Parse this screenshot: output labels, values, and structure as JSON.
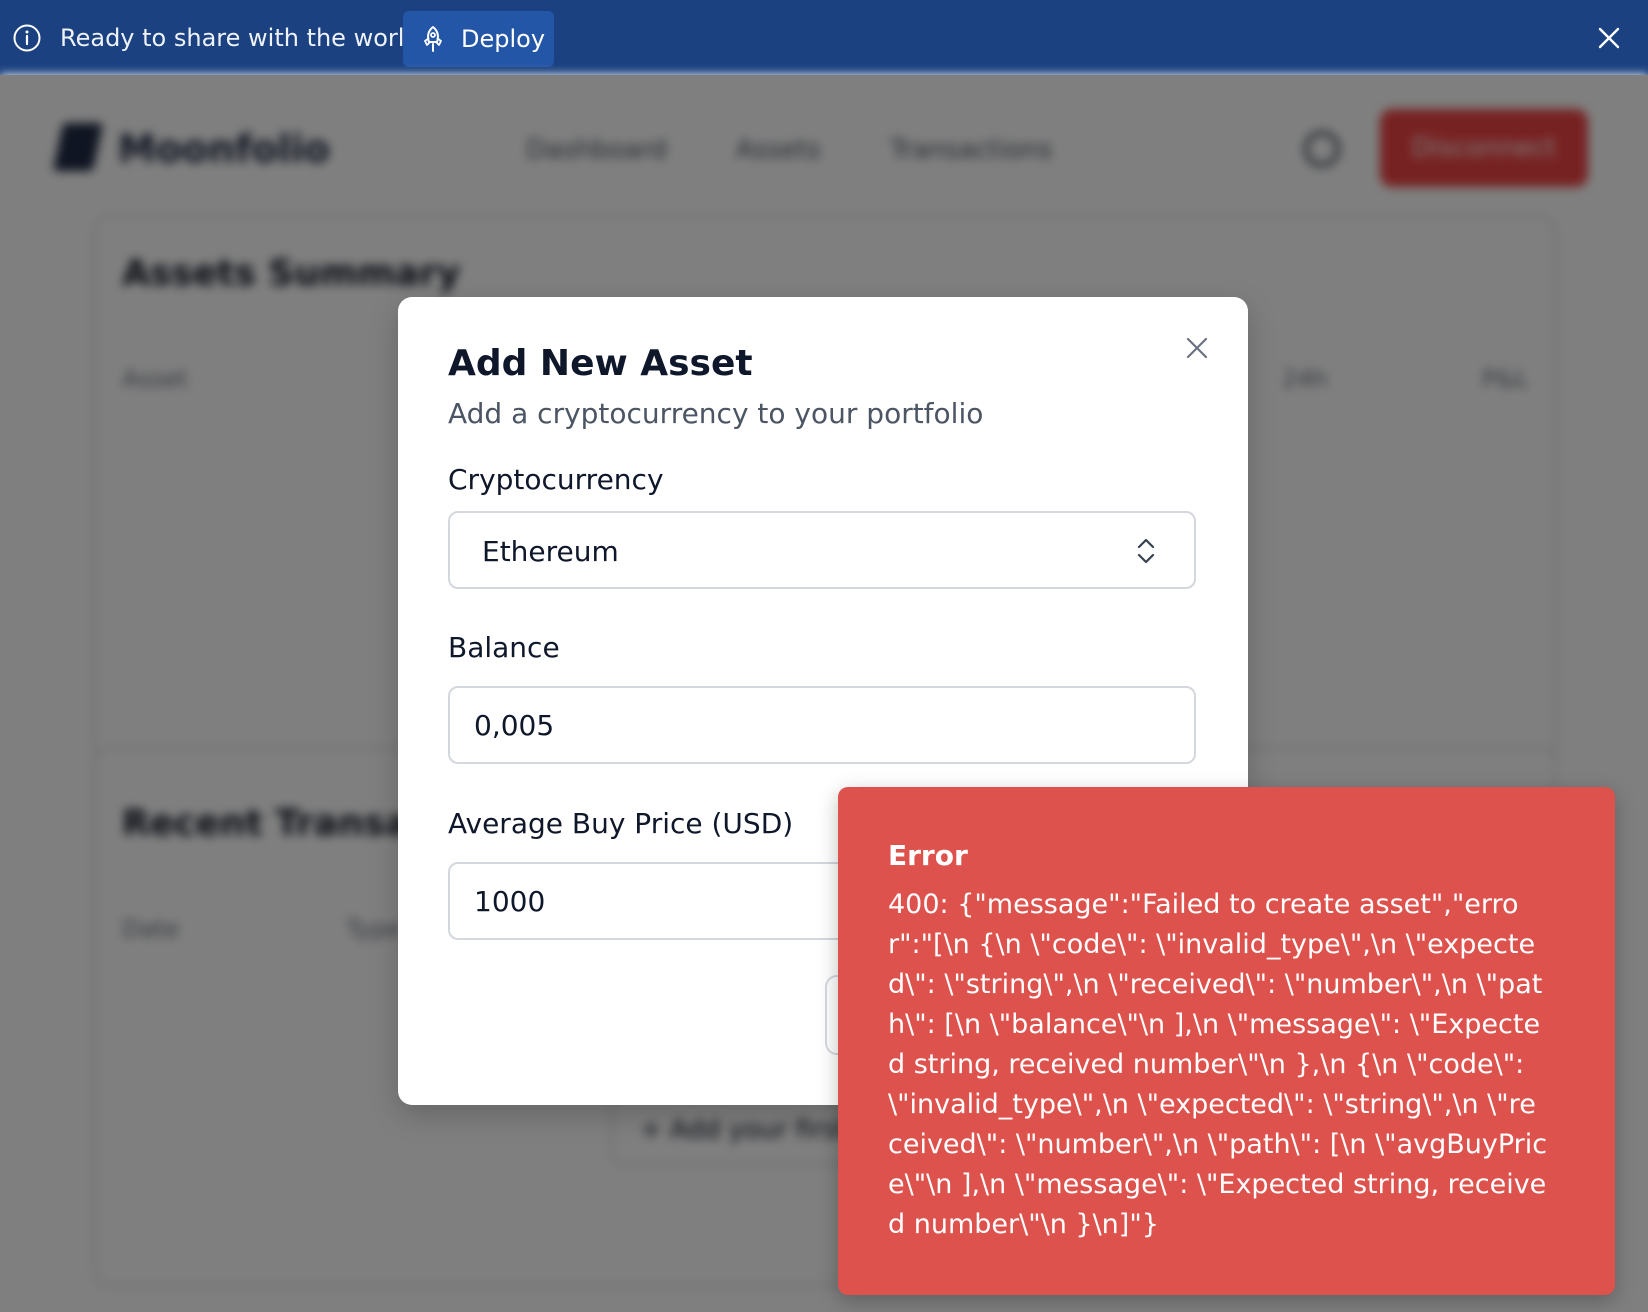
{
  "banner": {
    "message": "Ready to share with the world?",
    "deploy_label": "Deploy",
    "info_icon": "info-icon",
    "deploy_icon": "rocket-icon",
    "close_icon": "close-icon"
  },
  "app": {
    "logo_text": "Moonfolio",
    "nav": [
      "Dashboard",
      "Assets",
      "Transactions"
    ],
    "disconnect_label": "Disconnect",
    "assets_card": {
      "title": "Assets Summary",
      "columns": [
        "Asset",
        "24h",
        "P&L"
      ]
    },
    "transactions_card": {
      "title": "Recent Transactions",
      "columns": [
        "Date",
        "Type"
      ],
      "empty_action": "+ Add your first transaction"
    }
  },
  "modal": {
    "title": "Add New Asset",
    "subtitle": "Add a cryptocurrency to your portfolio",
    "crypto_label": "Cryptocurrency",
    "crypto_value": "Ethereum",
    "balance_label": "Balance",
    "balance_value": "0,005",
    "price_label": "Average Buy Price (USD)",
    "price_value": "1000"
  },
  "toast": {
    "title": "Error",
    "body": "400: {\"message\":\"Failed to create asset\",\"error\":\"[\\n {\\n \\\"code\\\": \\\"invalid_type\\\",\\n \\\"expected\\\": \\\"string\\\",\\n \\\"received\\\": \\\"number\\\",\\n \\\"path\\\": [\\n \\\"balance\\\"\\n ],\\n \\\"message\\\": \\\"Expected string, received number\\\"\\n },\\n {\\n \\\"code\\\": \\\"invalid_type\\\",\\n \\\"expected\\\": \\\"string\\\",\\n \\\"received\\\": \\\"number\\\",\\n \\\"path\\\": [\\n \\\"avgBuyPrice\\\"\\n ],\\n \\\"message\\\": \\\"Expected string, received number\\\"\\n }\\n]\"}"
  },
  "colors": {
    "banner_bg": "#1b4180",
    "deploy_bg": "#2456a7",
    "toast_bg": "#de524d",
    "disconnect_bg": "#ef4444"
  }
}
